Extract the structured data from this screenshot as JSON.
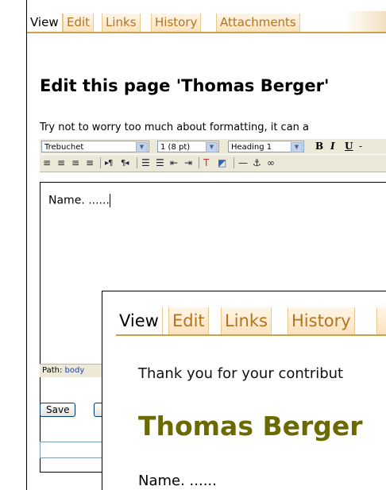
{
  "back_window": {
    "tabs": [
      {
        "label": "View",
        "active": true
      },
      {
        "label": "Edit"
      },
      {
        "label": "Links"
      },
      {
        "label": "History"
      },
      {
        "label": "Attachments"
      }
    ],
    "heading": "Edit this page 'Thomas Berger'",
    "tip": "Try not to worry too much about formatting, it can a",
    "toolbar": {
      "font_select": "Trebuchet",
      "size_select": "1 (8 pt)",
      "style_select": "Heading 1",
      "bold": "B",
      "italic": "I",
      "underline": "U"
    },
    "editor_text": "Name. ......",
    "path_label": "Path:",
    "path_value": "body",
    "save_button": "Save"
  },
  "front_window": {
    "tabs": [
      {
        "label": "View",
        "active": true
      },
      {
        "label": "Edit"
      },
      {
        "label": "Links"
      },
      {
        "label": "History"
      }
    ],
    "thanks_text": "Thank you for your contribut",
    "page_title": "Thomas Berger",
    "body_text": "Name. ......"
  },
  "colors": {
    "tab_text": "#b3741f",
    "tab_underline": "#c9a24a",
    "title_olive": "#6b6a00",
    "toolbar_bg": "#ece9d8"
  }
}
